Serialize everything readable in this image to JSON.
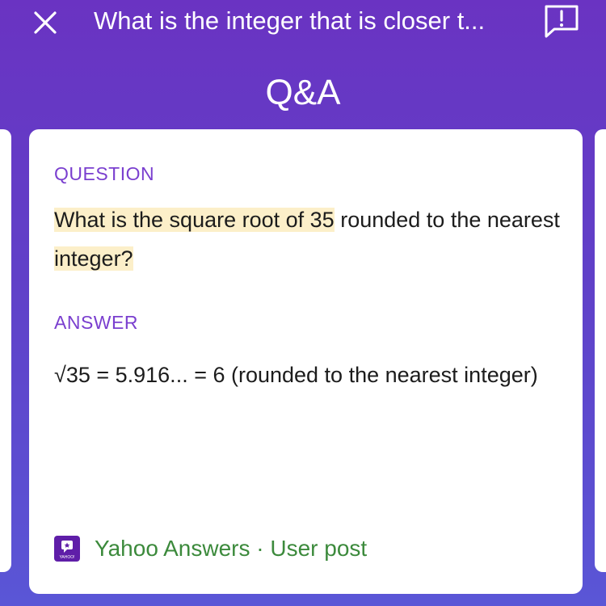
{
  "header": {
    "title": "What is the integer that is closer t...",
    "close_icon": "close-icon",
    "feedback_icon": "feedback-icon"
  },
  "section": {
    "title": "Q&A"
  },
  "card": {
    "question_label": "QUESTION",
    "question_highlight_1": "What is the square root of 35",
    "question_plain": " rounded to the nearest ",
    "question_highlight_2": "integer?",
    "answer_label": "ANSWER",
    "answer_text": "√35 = 5.916... = 6 (rounded to the nearest integer)",
    "source_logo": "yahoo-answers-logo",
    "source_logo_text": "YAHOO!",
    "source_text": "Yahoo Answers · User post"
  },
  "colors": {
    "background_top": "#6a33c2",
    "background_bottom": "#5a56d6",
    "label": "#7a3fcf",
    "highlight": "#fcefc9",
    "source": "#3c8a3c",
    "logo": "#5f1ea8"
  }
}
